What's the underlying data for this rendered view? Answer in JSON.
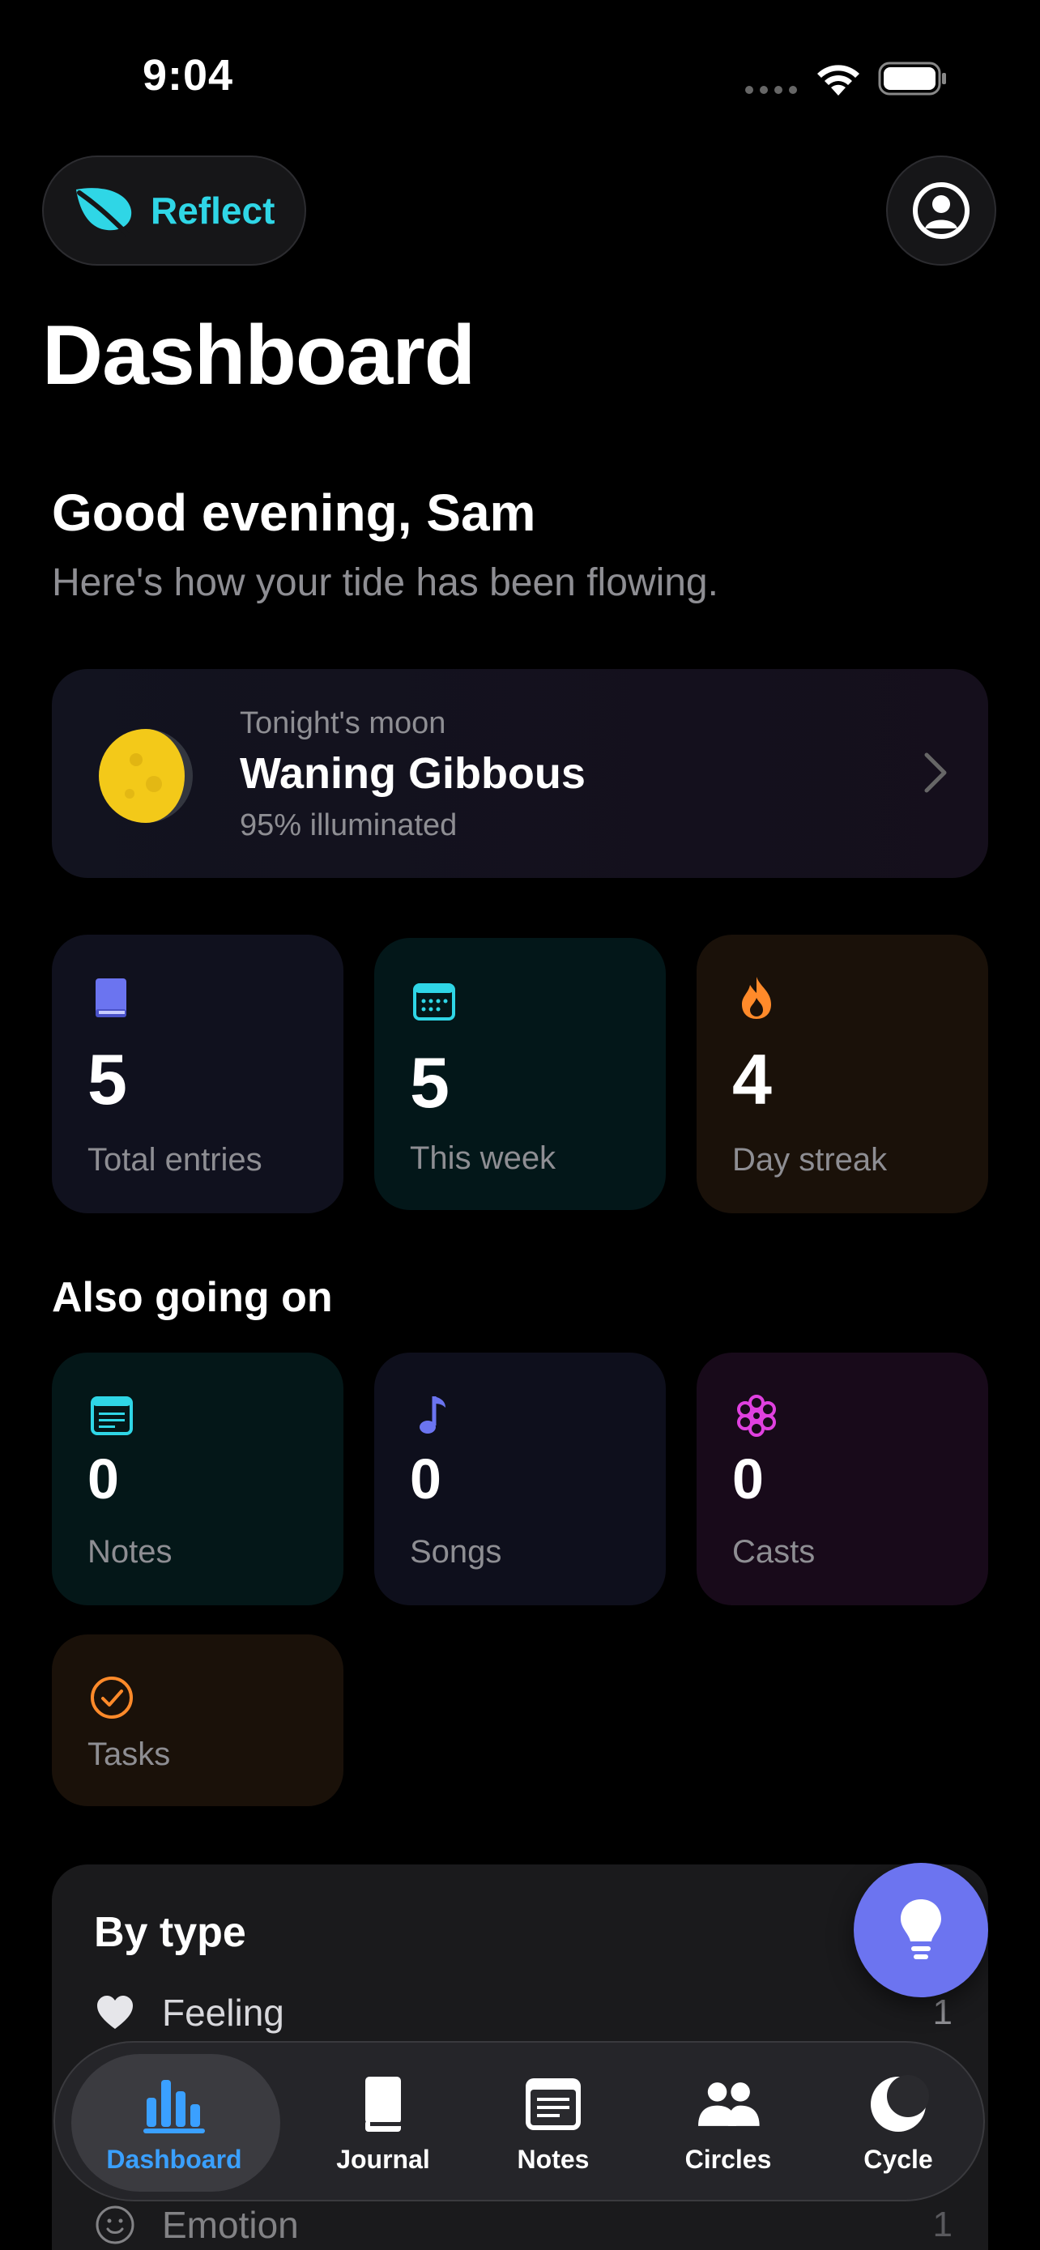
{
  "status": {
    "time": "9:04"
  },
  "header": {
    "app_name": "Reflect",
    "title": "Dashboard"
  },
  "greeting": {
    "title": "Good evening, Sam",
    "subtitle": "Here's how your tide has been flowing."
  },
  "moon": {
    "caption": "Tonight's moon",
    "phase": "Waning Gibbous",
    "illumination": "95% illuminated"
  },
  "stats": [
    {
      "value": "5",
      "label": "Total entries",
      "icon": "book-icon",
      "color": "#6b74f0"
    },
    {
      "value": "5",
      "label": "This week",
      "icon": "calendar-icon",
      "color": "#2fd6e6"
    },
    {
      "value": "4",
      "label": "Day streak",
      "icon": "flame-icon",
      "color": "#ff8a2a"
    }
  ],
  "also": {
    "title": "Also going on",
    "items": [
      {
        "value": "0",
        "label": "Notes",
        "icon": "note-icon",
        "color": "#2fd6e6"
      },
      {
        "value": "0",
        "label": "Songs",
        "icon": "music-note-icon",
        "color": "#6b74f0"
      },
      {
        "value": "0",
        "label": "Casts",
        "icon": "flower-icon",
        "color": "#e040e0"
      },
      {
        "label": "Tasks",
        "icon": "checkmark-circle-icon",
        "color": "#ff8a2a"
      }
    ]
  },
  "by_type": {
    "title": "By type",
    "rows": [
      {
        "name": "Feeling",
        "count": "1",
        "icon": "heart-icon"
      },
      {
        "name": "Emotion",
        "count": "1",
        "icon": "smiley-icon"
      }
    ]
  },
  "tabs": [
    {
      "label": "Dashboard",
      "icon": "chart-bars-icon",
      "active": true
    },
    {
      "label": "Journal",
      "icon": "book-icon"
    },
    {
      "label": "Notes",
      "icon": "note-icon"
    },
    {
      "label": "Circles",
      "icon": "people-icon"
    },
    {
      "label": "Cycle",
      "icon": "moon-icon"
    }
  ],
  "colors": {
    "accent": "#2fd6e6",
    "fab": "#6c74f0",
    "active_tab": "#3aa0ff"
  }
}
